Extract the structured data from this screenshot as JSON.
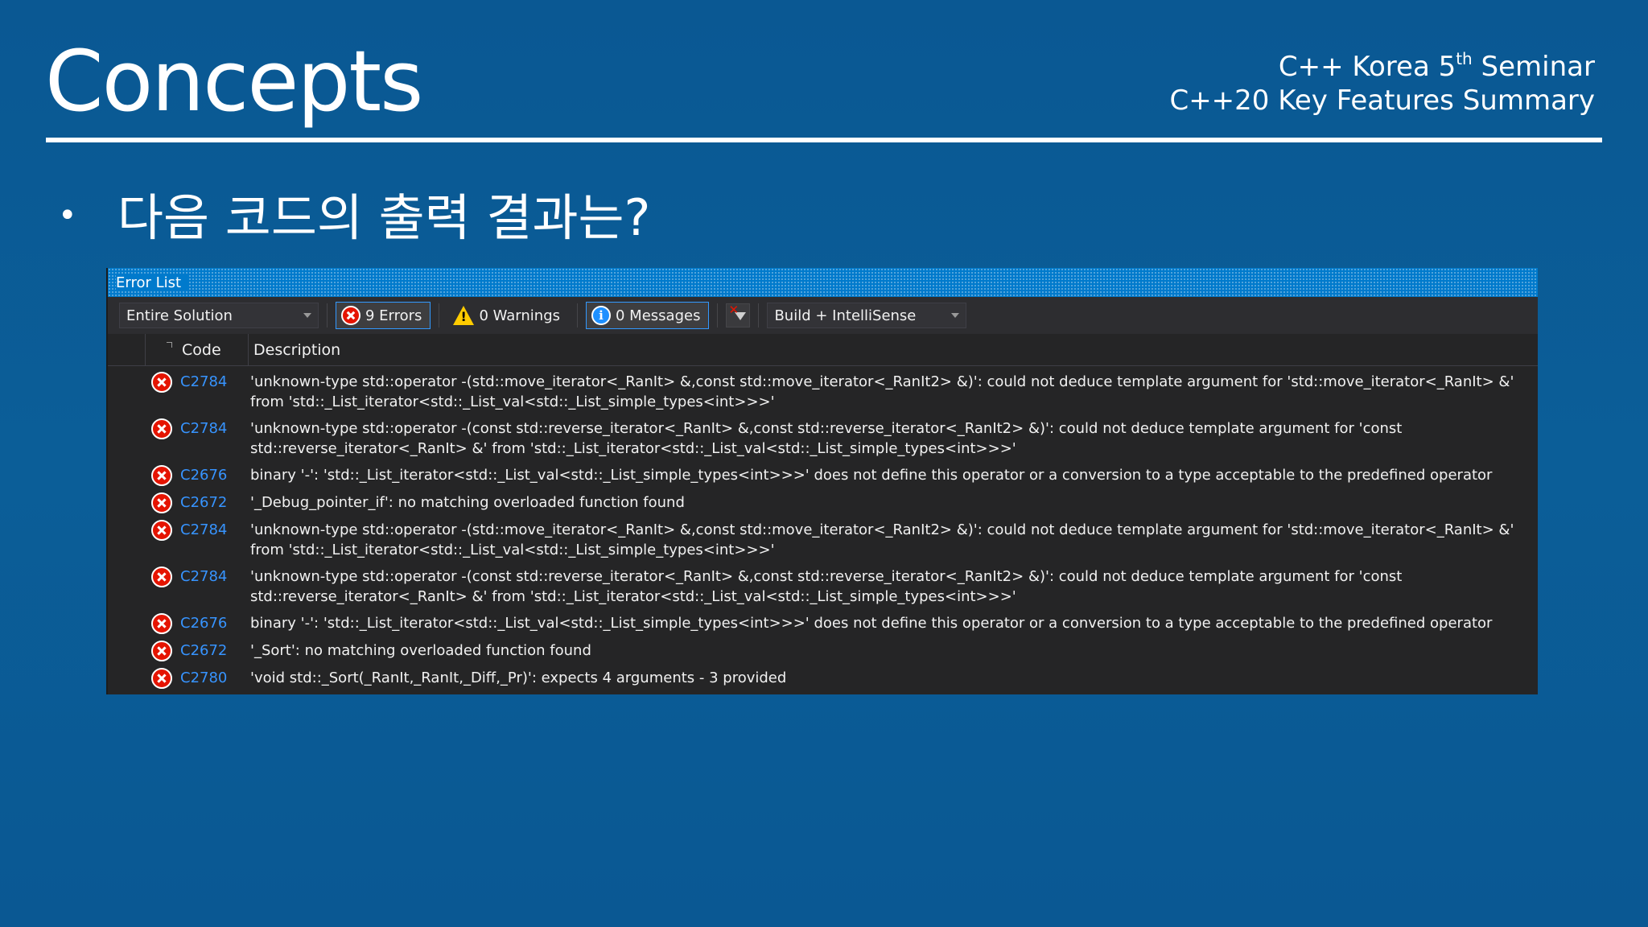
{
  "slide": {
    "title": "Concepts",
    "subtitle_line1_prefix": "C++ Korea 5",
    "subtitle_line1_sup": "th",
    "subtitle_line1_suffix": " Seminar",
    "subtitle_line2": "C++20 Key Features Summary",
    "bullet": "•",
    "question": "다음 코드의 출력 결과는?"
  },
  "error_list": {
    "title": "Error List",
    "scope": "Entire Solution",
    "errors_label": "9 Errors",
    "warnings_label": "0 Warnings",
    "messages_label": "0 Messages",
    "source": "Build + IntelliSense",
    "columns": {
      "code": "Code",
      "description": "Description"
    },
    "rows": [
      {
        "code": "C2784",
        "description": "'unknown-type std::operator -(std::move_iterator<_RanIt> &,const std::move_iterator<_RanIt2> &)': could not deduce template argument for 'std::move_iterator<_RanIt> &' from 'std::_List_iterator<std::_List_val<std::_List_simple_types<int>>>'"
      },
      {
        "code": "C2784",
        "description": "'unknown-type std::operator -(const std::reverse_iterator<_RanIt> &,const std::reverse_iterator<_RanIt2> &)': could not deduce template argument for 'const std::reverse_iterator<_RanIt> &' from 'std::_List_iterator<std::_List_val<std::_List_simple_types<int>>>'"
      },
      {
        "code": "C2676",
        "description": "binary '-': 'std::_List_iterator<std::_List_val<std::_List_simple_types<int>>>' does not define this operator or a conversion to a type acceptable to the predefined operator"
      },
      {
        "code": "C2672",
        "description": "'_Debug_pointer_if': no matching overloaded function found"
      },
      {
        "code": "C2784",
        "description": "'unknown-type std::operator -(std::move_iterator<_RanIt> &,const std::move_iterator<_RanIt2> &)': could not deduce template argument for 'std::move_iterator<_RanIt> &' from 'std::_List_iterator<std::_List_val<std::_List_simple_types<int>>>'"
      },
      {
        "code": "C2784",
        "description": "'unknown-type std::operator -(const std::reverse_iterator<_RanIt> &,const std::reverse_iterator<_RanIt2> &)': could not deduce template argument for 'const std::reverse_iterator<_RanIt> &' from 'std::_List_iterator<std::_List_val<std::_List_simple_types<int>>>'"
      },
      {
        "code": "C2676",
        "description": "binary '-': 'std::_List_iterator<std::_List_val<std::_List_simple_types<int>>>' does not define this operator or a conversion to a type acceptable to the predefined operator"
      },
      {
        "code": "C2672",
        "description": "'_Sort': no matching overloaded function found"
      },
      {
        "code": "C2780",
        "description": "'void std::_Sort(_RanIt,_RanIt,_Diff,_Pr)': expects 4 arguments - 3 provided"
      }
    ]
  },
  "icons": {
    "error": "error-circle-icon",
    "warning": "warning-triangle-icon",
    "info": "info-circle-icon",
    "filter": "clear-filter-icon"
  },
  "colors": {
    "slide_background": "#0b5c96",
    "panel_background": "#252526",
    "titlebar": "#007acc",
    "error_red": "#e51400",
    "code_link": "#3794ff"
  }
}
